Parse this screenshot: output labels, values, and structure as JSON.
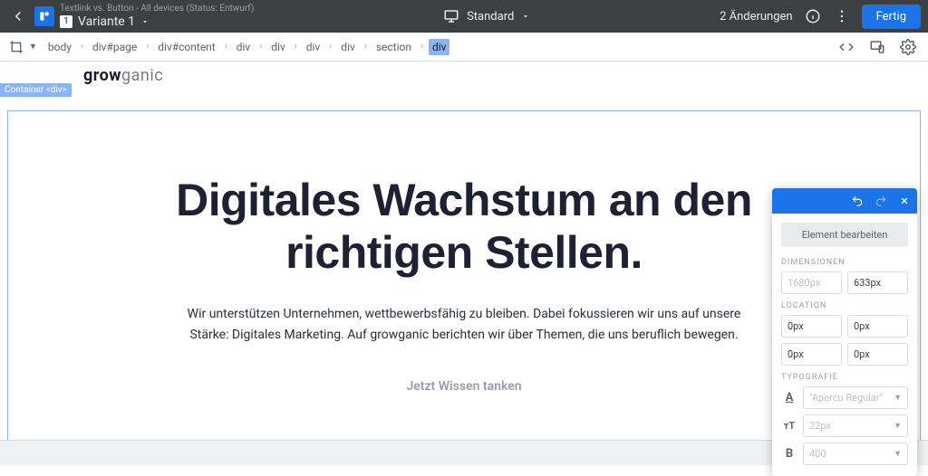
{
  "header": {
    "subtitle": "Textlink vs. Button - All devices (Status: Entwurf)",
    "variant_badge": "1",
    "variant_label": "Variante 1",
    "device_mode": "Standard",
    "changes_text": "2 Änderungen",
    "done_label": "Fertig"
  },
  "breadcrumbs": [
    "body",
    "div#page",
    "div#content",
    "div",
    "div",
    "div",
    "div",
    "section",
    "div"
  ],
  "container_tag": "Container <div>",
  "site": {
    "brand_bold": "grow",
    "brand_light": "ganic",
    "hero_title": "Digitales Wachstum an den richtigen Stellen.",
    "hero_body": "Wir unterstützen Unternehmen, wettbewerbsfähig zu bleiben. Dabei fokussieren wir uns auf unsere Stärke: Digitales Marketing. Auf growganic berichten wir über Themen, die uns beruflich bewegen.",
    "hero_cta": "Jetzt Wissen tanken"
  },
  "inspector": {
    "edit_label": "Element bearbeiten",
    "dimensions_label": "Dimensionen",
    "width_placeholder": "1680px",
    "height_value": "633px",
    "location_label": "Location",
    "loc_values": [
      "0px",
      "0px",
      "0px",
      "0px"
    ],
    "typography_label": "Typografie",
    "font_family": "\"Apercu Regular\"",
    "font_size": "22px",
    "font_weight": "400"
  }
}
